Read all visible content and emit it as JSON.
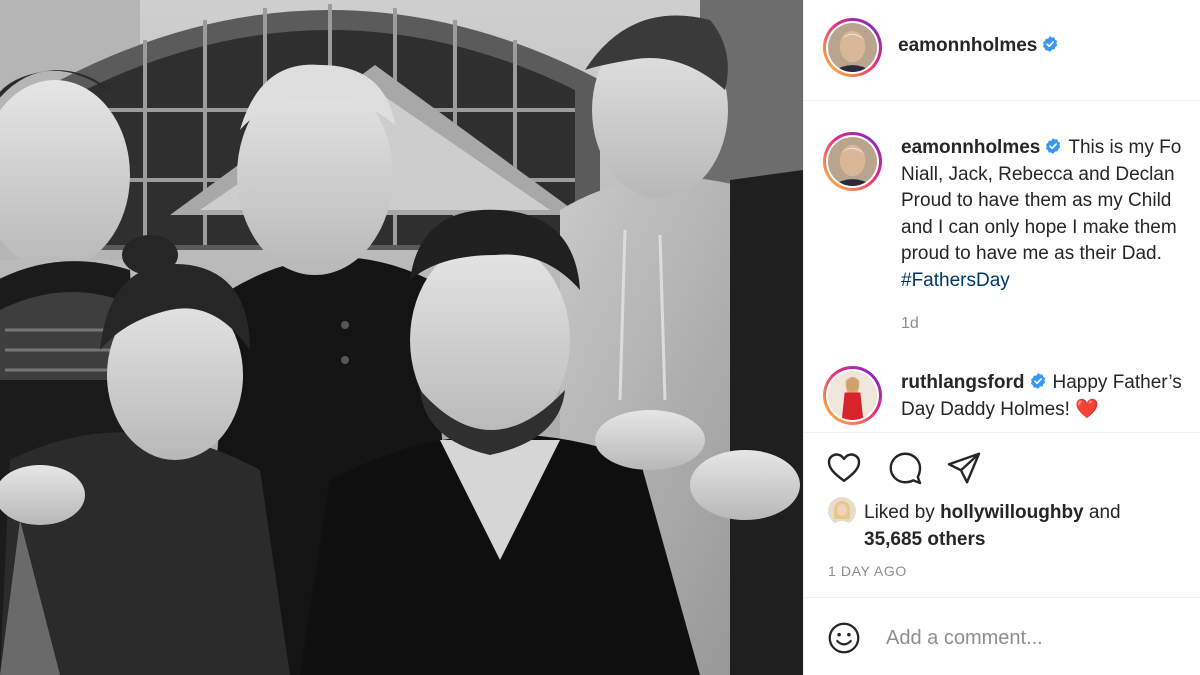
{
  "post": {
    "username": "eamonnholmes",
    "verified": true,
    "photo_alt": "Black and white family photo"
  },
  "caption": {
    "username": "eamonnholmes",
    "lines": [
      "This is my Fo",
      "Niall, Jack, Rebecca and Declan",
      "Proud to have them as my Child",
      "and I can only hope I make them",
      "proud to have me as their Dad."
    ],
    "hashtag": "#FathersDay",
    "age": "1d"
  },
  "reply": {
    "username": "ruthlangsford",
    "line1": "Happy Father’s",
    "line2": "Day Daddy Holmes!",
    "emoji": "❤️"
  },
  "actions": {
    "like_icon": "heart-icon",
    "comment_icon": "comment-bubble-icon",
    "share_icon": "paper-plane-icon"
  },
  "likes": {
    "prefix": "Liked by",
    "user": "hollywilloughby",
    "and": "and",
    "count": "35,685 others"
  },
  "timestamp": "1 DAY AGO",
  "add_comment": {
    "placeholder": "Add a comment...",
    "emoji_icon": "smiley-icon"
  },
  "colors": {
    "verified_blue": "#3897f0",
    "hashtag": "#00376b",
    "muted": "#8e8e8e",
    "heart_red": "#e0245e"
  }
}
